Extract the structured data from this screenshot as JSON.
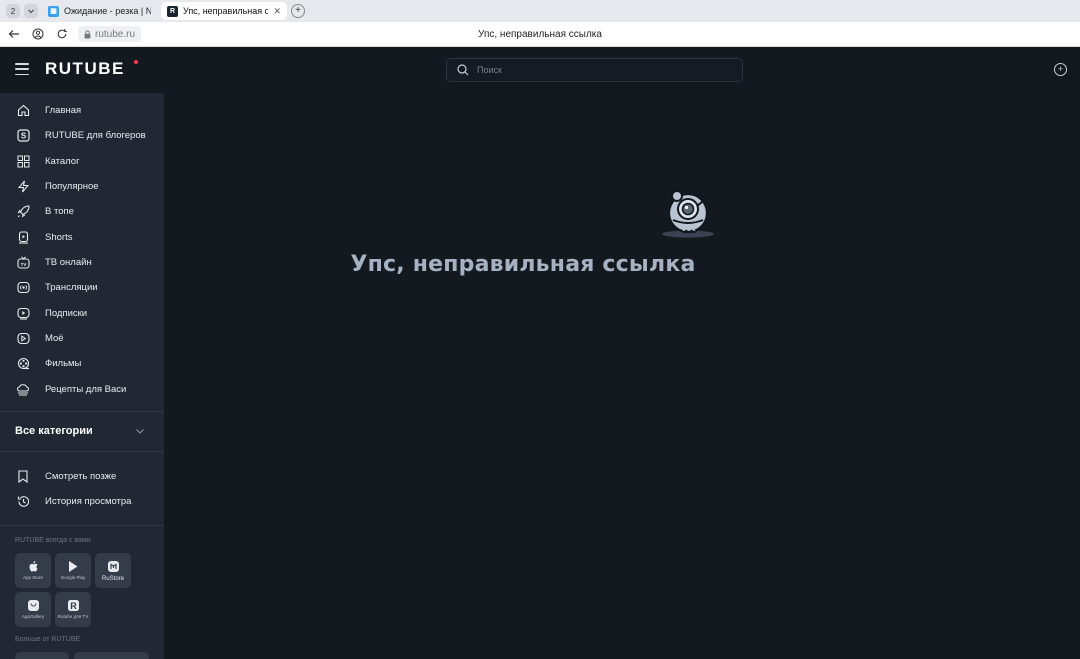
{
  "browser": {
    "tab_count": "2",
    "tabs": [
      {
        "title": "Ожидание - резка | NEXT",
        "favicon_color": "#3aa0f0",
        "active": false
      },
      {
        "title": "Упс, неправильная ссылка",
        "favicon_color": "#1a2230",
        "active": true
      }
    ],
    "address": "rutube.ru",
    "page_heading": "Упс, неправильная ссылка"
  },
  "header": {
    "logo": "RUTUBE",
    "search_placeholder": "Поиск",
    "logo_accent": "#ff3a4d"
  },
  "sidebar": {
    "items": [
      {
        "label": "Главная",
        "icon": "home-icon"
      },
      {
        "label": "RUTUBE для блогеров",
        "icon": "studio-icon"
      },
      {
        "label": "Каталог",
        "icon": "catalog-icon"
      },
      {
        "label": "Популярное",
        "icon": "popular-icon"
      },
      {
        "label": "В топе",
        "icon": "rocket-icon"
      },
      {
        "label": "Shorts",
        "icon": "shorts-icon"
      },
      {
        "label": "ТВ онлайн",
        "icon": "tv-icon"
      },
      {
        "label": "Трансляции",
        "icon": "live-icon"
      },
      {
        "label": "Подписки",
        "icon": "subscriptions-icon"
      },
      {
        "label": "Моё",
        "icon": "my-icon"
      },
      {
        "label": "Фильмы",
        "icon": "films-icon"
      },
      {
        "label": "Рецепты для Васи",
        "icon": "chef-hat-icon"
      }
    ],
    "all_categories": "Все категории",
    "library": [
      {
        "label": "Смотреть позже",
        "icon": "bookmark-icon"
      },
      {
        "label": "История просмотра",
        "icon": "history-icon"
      }
    ],
    "apps_caption": "RUTUBE всегда с вами",
    "stores": [
      {
        "label": "App Store",
        "icon": "apple-icon"
      },
      {
        "label": "Google Play",
        "icon": "google-play-icon"
      },
      {
        "label": "RuStore",
        "icon": "rustore-icon"
      },
      {
        "label": "AppGallery",
        "icon": "appgallery-icon"
      },
      {
        "label": "Rutube для TV",
        "icon": "rutube-tv-icon"
      }
    ],
    "more_caption": "Больше от RUTUBE"
  },
  "error": {
    "title": "Упс, неправильная ссылка"
  }
}
